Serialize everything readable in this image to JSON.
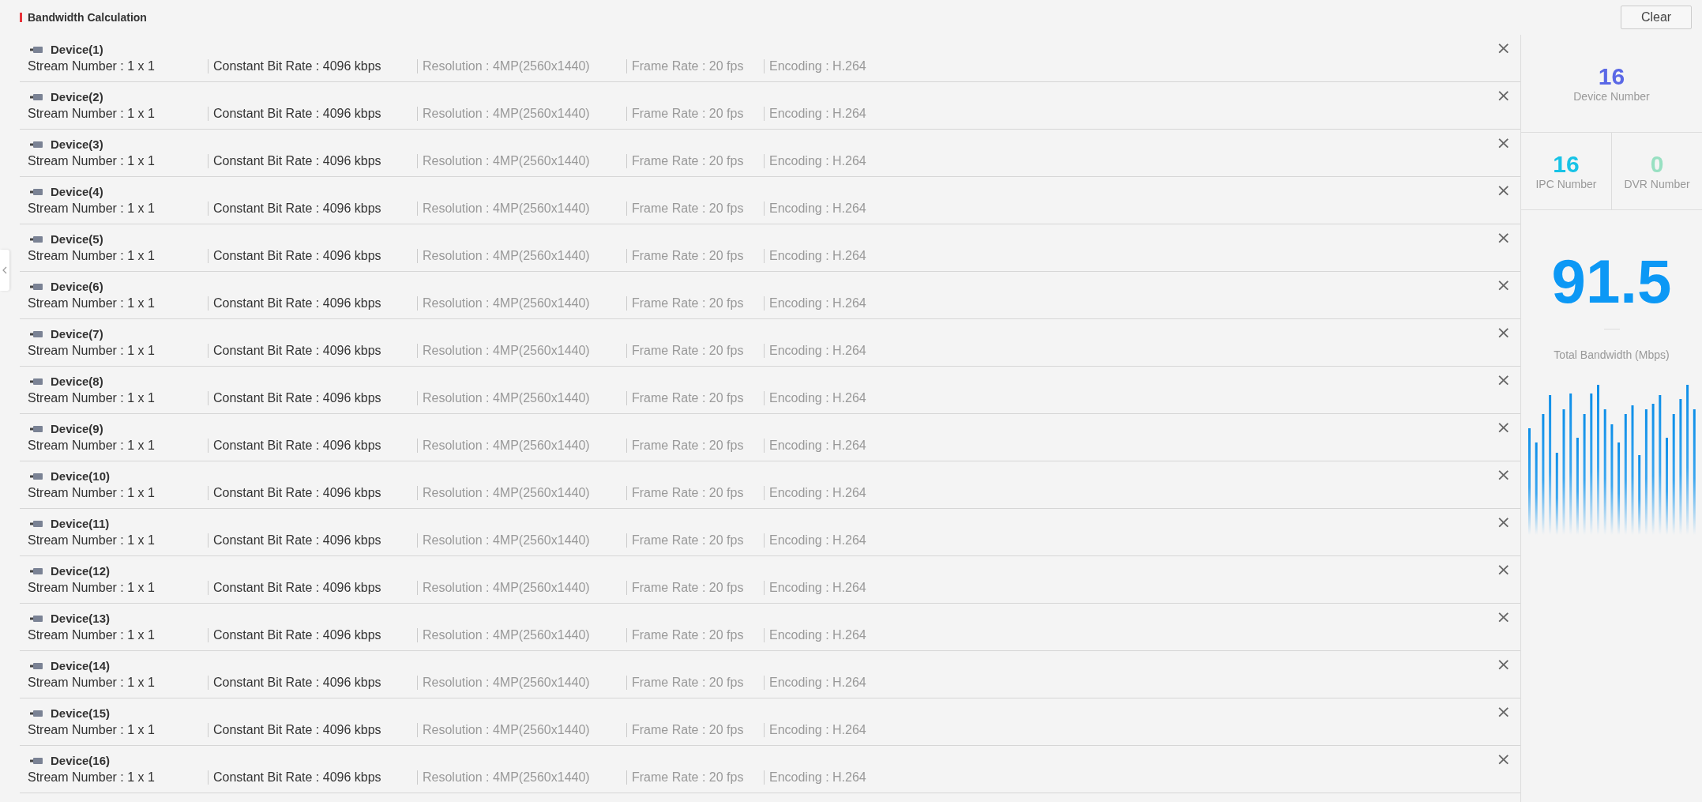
{
  "header": {
    "title": "Bandwidth Calculation",
    "clear_button": "Clear"
  },
  "devices": [
    {
      "name": "Device(1)",
      "fields": [
        "Stream Number : 1 x 1",
        "Constant Bit Rate : 4096 kbps",
        "Resolution : 4MP(2560x1440)",
        "Frame Rate : 20 fps",
        "Encoding : H.264"
      ],
      "close": "×"
    },
    {
      "name": "Device(2)",
      "fields": [
        "Stream Number : 1 x 1",
        "Constant Bit Rate : 4096 kbps",
        "Resolution : 4MP(2560x1440)",
        "Frame Rate : 20 fps",
        "Encoding : H.264"
      ],
      "close": "×"
    },
    {
      "name": "Device(3)",
      "fields": [
        "Stream Number : 1 x 1",
        "Constant Bit Rate : 4096 kbps",
        "Resolution : 4MP(2560x1440)",
        "Frame Rate : 20 fps",
        "Encoding : H.264"
      ],
      "close": "×"
    },
    {
      "name": "Device(4)",
      "fields": [
        "Stream Number : 1 x 1",
        "Constant Bit Rate : 4096 kbps",
        "Resolution : 4MP(2560x1440)",
        "Frame Rate : 20 fps",
        "Encoding : H.264"
      ],
      "close": "×"
    },
    {
      "name": "Device(5)",
      "fields": [
        "Stream Number : 1 x 1",
        "Constant Bit Rate : 4096 kbps",
        "Resolution : 4MP(2560x1440)",
        "Frame Rate : 20 fps",
        "Encoding : H.264"
      ],
      "close": "×"
    },
    {
      "name": "Device(6)",
      "fields": [
        "Stream Number : 1 x 1",
        "Constant Bit Rate : 4096 kbps",
        "Resolution : 4MP(2560x1440)",
        "Frame Rate : 20 fps",
        "Encoding : H.264"
      ],
      "close": "×"
    },
    {
      "name": "Device(7)",
      "fields": [
        "Stream Number : 1 x 1",
        "Constant Bit Rate : 4096 kbps",
        "Resolution : 4MP(2560x1440)",
        "Frame Rate : 20 fps",
        "Encoding : H.264"
      ],
      "close": "×"
    },
    {
      "name": "Device(8)",
      "fields": [
        "Stream Number : 1 x 1",
        "Constant Bit Rate : 4096 kbps",
        "Resolution : 4MP(2560x1440)",
        "Frame Rate : 20 fps",
        "Encoding : H.264"
      ],
      "close": "×"
    },
    {
      "name": "Device(9)",
      "fields": [
        "Stream Number : 1 x 1",
        "Constant Bit Rate : 4096 kbps",
        "Resolution : 4MP(2560x1440)",
        "Frame Rate : 20 fps",
        "Encoding : H.264"
      ],
      "close": "×"
    },
    {
      "name": "Device(10)",
      "fields": [
        "Stream Number : 1 x 1",
        "Constant Bit Rate : 4096 kbps",
        "Resolution : 4MP(2560x1440)",
        "Frame Rate : 20 fps",
        "Encoding : H.264"
      ],
      "close": "×"
    },
    {
      "name": "Device(11)",
      "fields": [
        "Stream Number : 1 x 1",
        "Constant Bit Rate : 4096 kbps",
        "Resolution : 4MP(2560x1440)",
        "Frame Rate : 20 fps",
        "Encoding : H.264"
      ],
      "close": "×"
    },
    {
      "name": "Device(12)",
      "fields": [
        "Stream Number : 1 x 1",
        "Constant Bit Rate : 4096 kbps",
        "Resolution : 4MP(2560x1440)",
        "Frame Rate : 20 fps",
        "Encoding : H.264"
      ],
      "close": "×"
    },
    {
      "name": "Device(13)",
      "fields": [
        "Stream Number : 1 x 1",
        "Constant Bit Rate : 4096 kbps",
        "Resolution : 4MP(2560x1440)",
        "Frame Rate : 20 fps",
        "Encoding : H.264"
      ],
      "close": "×"
    },
    {
      "name": "Device(14)",
      "fields": [
        "Stream Number : 1 x 1",
        "Constant Bit Rate : 4096 kbps",
        "Resolution : 4MP(2560x1440)",
        "Frame Rate : 20 fps",
        "Encoding : H.264"
      ],
      "close": "×"
    },
    {
      "name": "Device(15)",
      "fields": [
        "Stream Number : 1 x 1",
        "Constant Bit Rate : 4096 kbps",
        "Resolution : 4MP(2560x1440)",
        "Frame Rate : 20 fps",
        "Encoding : H.264"
      ],
      "close": "×"
    },
    {
      "name": "Device(16)",
      "fields": [
        "Stream Number : 1 x 1",
        "Constant Bit Rate : 4096 kbps",
        "Resolution : 4MP(2560x1440)",
        "Frame Rate : 20 fps",
        "Encoding : H.264"
      ],
      "close": "×"
    }
  ],
  "summary": {
    "device_number": {
      "value": "16",
      "label": "Device Number"
    },
    "ipc_number": {
      "value": "16",
      "label": "IPC Number"
    },
    "dvr_number": {
      "value": "0",
      "label": "DVR Number"
    },
    "total_bandwidth": {
      "value": "91.5",
      "label": "Total Bandwidth (Mbps)"
    }
  }
}
